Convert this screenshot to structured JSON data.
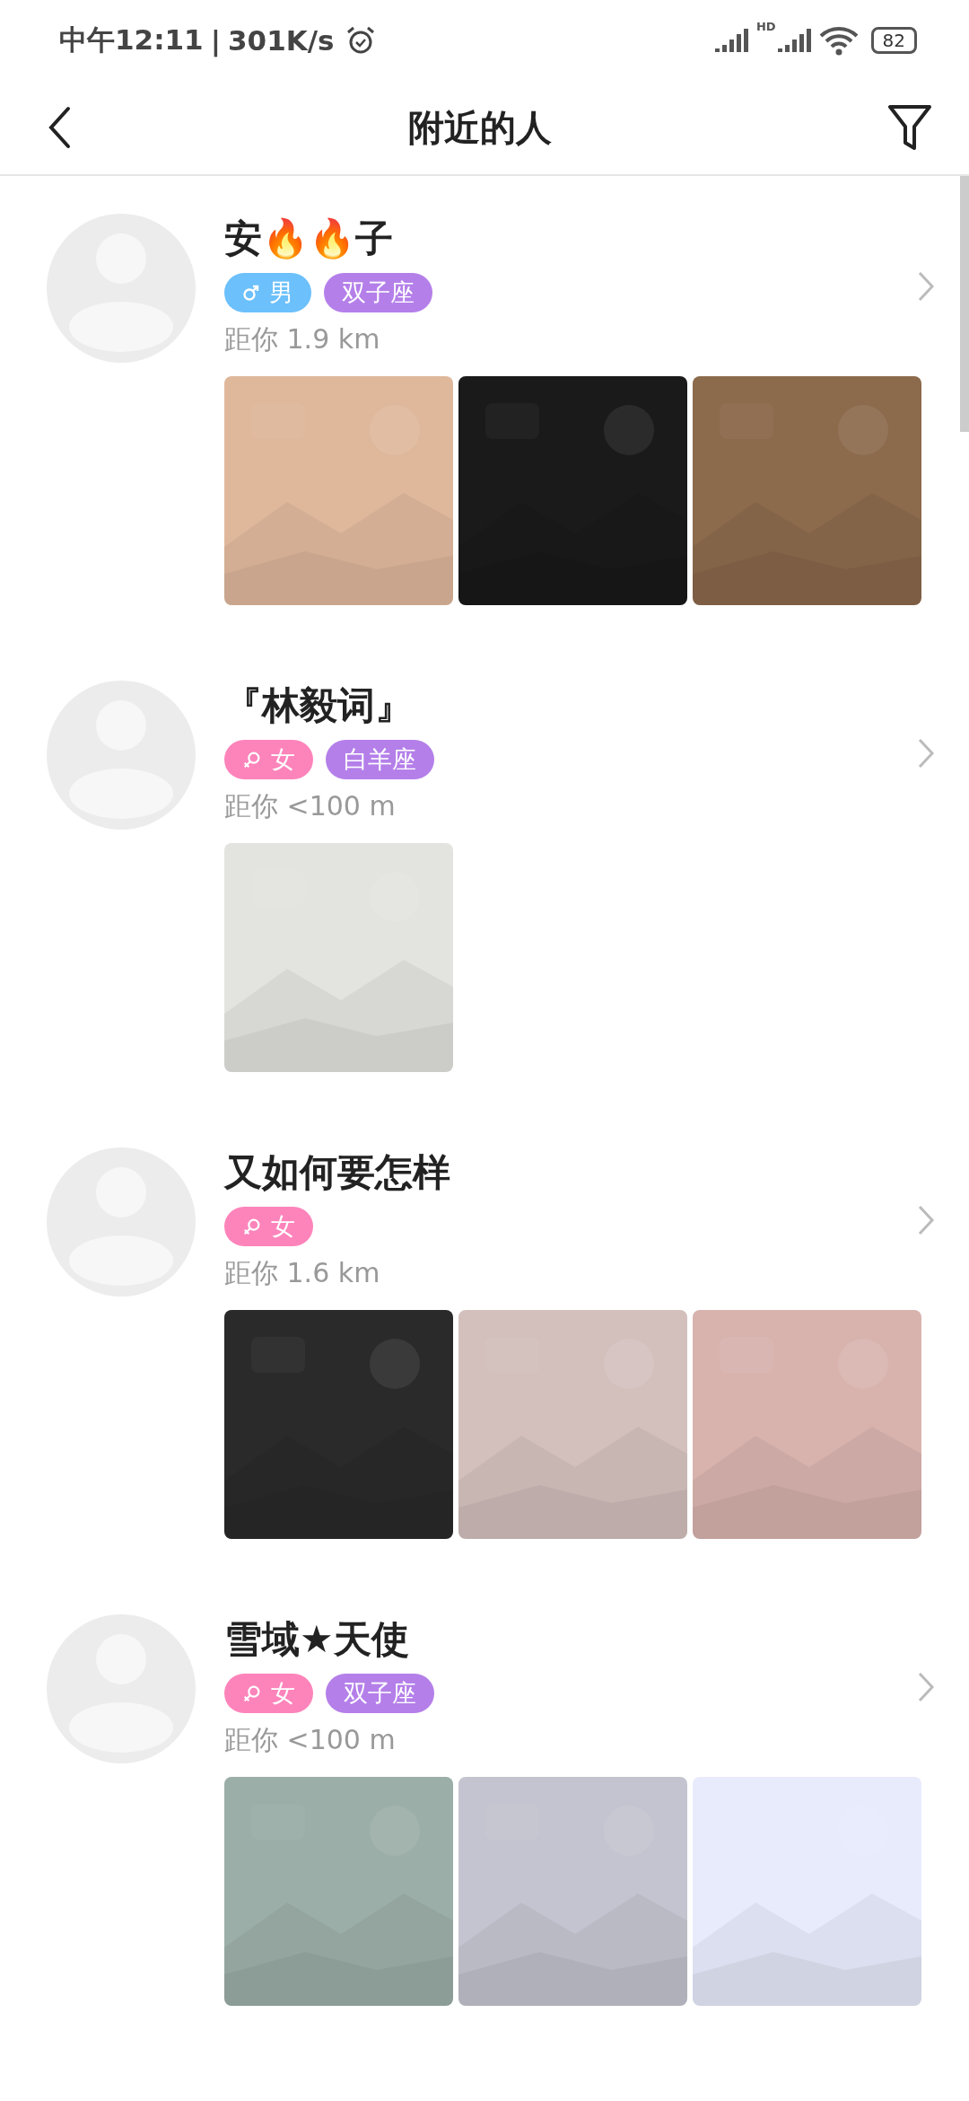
{
  "status_bar": {
    "time": "中午12:11",
    "separator": "|",
    "speed": "301K/s",
    "signal_label": "HD",
    "battery": "82"
  },
  "header": {
    "title": "附近的人"
  },
  "people": [
    {
      "name": "安🔥🔥子",
      "tags": [
        {
          "kind": "male",
          "text": "男"
        },
        {
          "kind": "zodiac",
          "text": "双子座"
        }
      ],
      "distance": "距你 1.9 km",
      "photos": [
        {
          "kind": "picture"
        },
        {
          "kind": "picture"
        },
        {
          "kind": "picture"
        }
      ]
    },
    {
      "name": "『林毅词』",
      "tags": [
        {
          "kind": "female",
          "text": "女"
        },
        {
          "kind": "zodiac",
          "text": "白羊座"
        }
      ],
      "distance": "距你 <100 m",
      "photos": [
        {
          "kind": "picture"
        }
      ]
    },
    {
      "name": "又如何要怎样",
      "tags": [
        {
          "kind": "female",
          "text": "女"
        }
      ],
      "distance": "距你 1.6 km",
      "photos": [
        {
          "kind": "picture"
        },
        {
          "kind": "picture"
        },
        {
          "kind": "picture"
        }
      ]
    },
    {
      "name": "雪域★天使",
      "tags": [
        {
          "kind": "female",
          "text": "女"
        },
        {
          "kind": "zodiac",
          "text": "双子座"
        }
      ],
      "distance": "距你 <100 m",
      "photos": [
        {
          "kind": "picture"
        },
        {
          "kind": "picture"
        },
        {
          "kind": "picture"
        }
      ]
    }
  ]
}
